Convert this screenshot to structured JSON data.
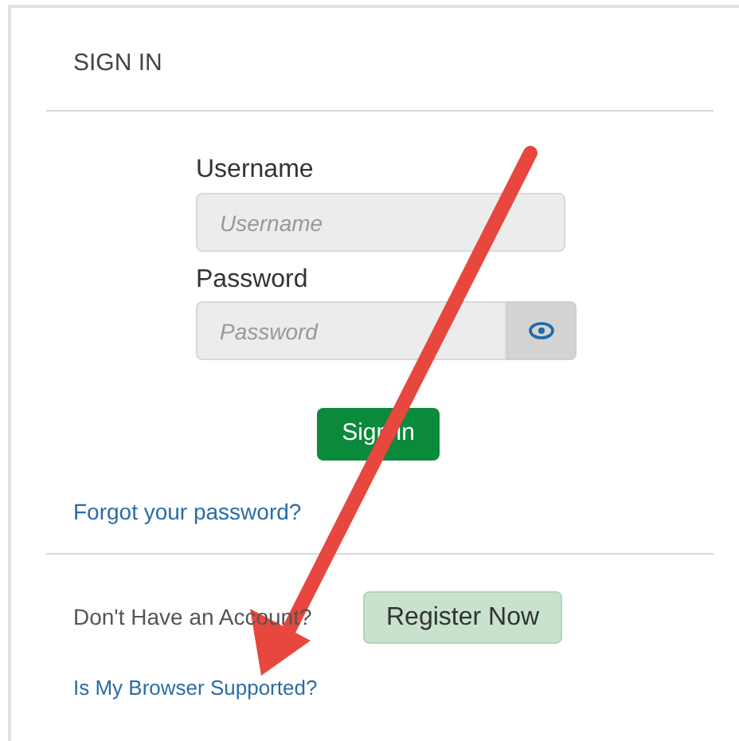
{
  "panel": {
    "title": "SIGN IN"
  },
  "form": {
    "username": {
      "label": "Username",
      "placeholder": "Username"
    },
    "password": {
      "label": "Password",
      "placeholder": "Password"
    },
    "submit": "Sign in",
    "forgot_link": "Forgot your password?"
  },
  "register": {
    "prompt": "Don't Have an Account?",
    "button": "Register Now"
  },
  "browser_link": "Is My Browser Supported?"
}
